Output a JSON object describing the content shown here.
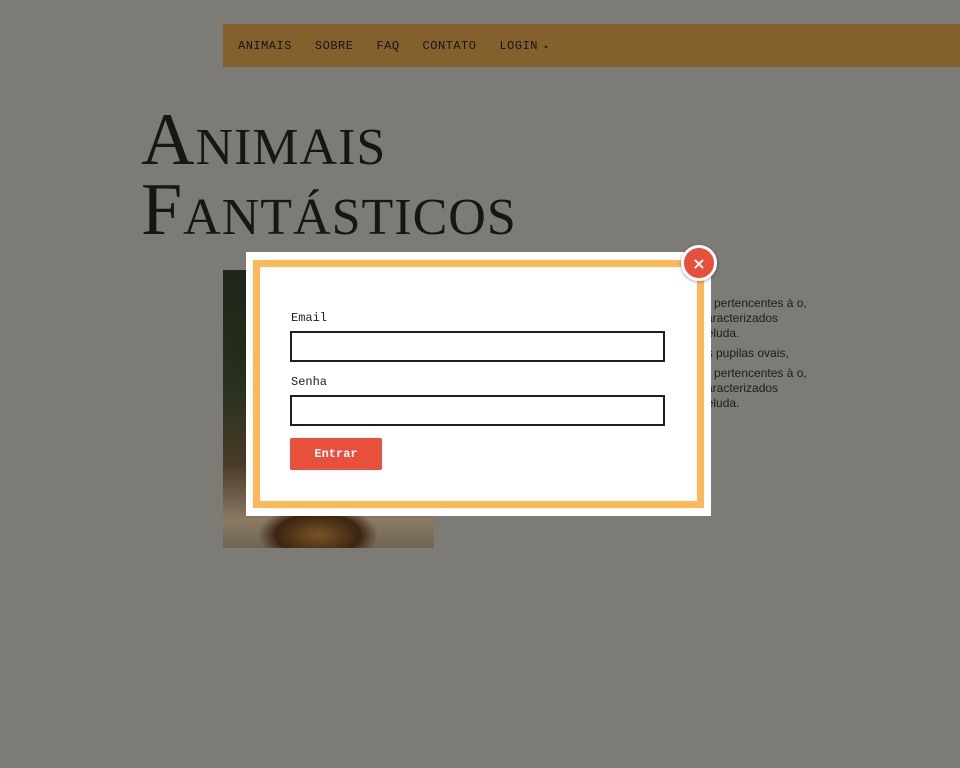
{
  "nav": {
    "items": [
      "ANIMAIS",
      "SOBRE",
      "FAQ",
      "CONTATO",
      "LOGIN"
    ],
    "login_arrow": "▸"
  },
  "page": {
    "title_line1": "Animais",
    "title_line2": "Fantásticos"
  },
  "content": {
    "paragraph1": "pertencentes à o, caracterizados peluda.",
    "paragraph2": "as pupilas ovais,",
    "paragraph3": "pertencentes à o, caracterizados peluda."
  },
  "login_modal": {
    "close_label": "×",
    "email_label": "Email",
    "email_value": "",
    "password_label": "Senha",
    "password_value": "",
    "submit_label": "Entrar"
  },
  "colors": {
    "overlay_background": "#7d7b76",
    "nav_background": "#84602c",
    "modal_border": "#fbb95a",
    "accent": "#e6503c"
  }
}
